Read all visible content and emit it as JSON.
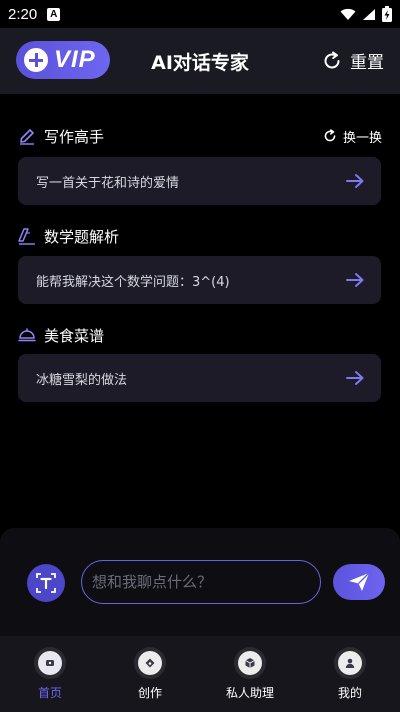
{
  "status_bar": {
    "time": "2:20",
    "notification_icon": "app-notification-icon",
    "icons": [
      "wifi-icon",
      "signal-icon",
      "battery-icon"
    ]
  },
  "header": {
    "vip_label": "VIP",
    "title": "AI对话专家",
    "reset_label": "重置"
  },
  "sections": [
    {
      "icon": "pen-icon",
      "title": "写作高手",
      "shuffle_label": "换一换",
      "prompt": "写一首关于花和诗的爱情"
    },
    {
      "icon": "pencil-ruler-icon",
      "title": "数学题解析",
      "prompt": "能帮我解决这个数学问题：3^(4)"
    },
    {
      "icon": "food-dome-icon",
      "title": "美食菜谱",
      "prompt": "冰糖雪梨的做法"
    }
  ],
  "input": {
    "placeholder": "想和我聊点什么？",
    "value": ""
  },
  "nav": [
    {
      "label": "首页",
      "icon": "home-icon",
      "active": true
    },
    {
      "label": "创作",
      "icon": "create-icon",
      "active": false
    },
    {
      "label": "私人助理",
      "icon": "assistant-icon",
      "active": false
    },
    {
      "label": "我的",
      "icon": "profile-icon",
      "active": false
    }
  ],
  "colors": {
    "accent": "#6e66f2",
    "card": "#1c1b27",
    "header": "#1a1a22",
    "nav": "#16161c"
  }
}
